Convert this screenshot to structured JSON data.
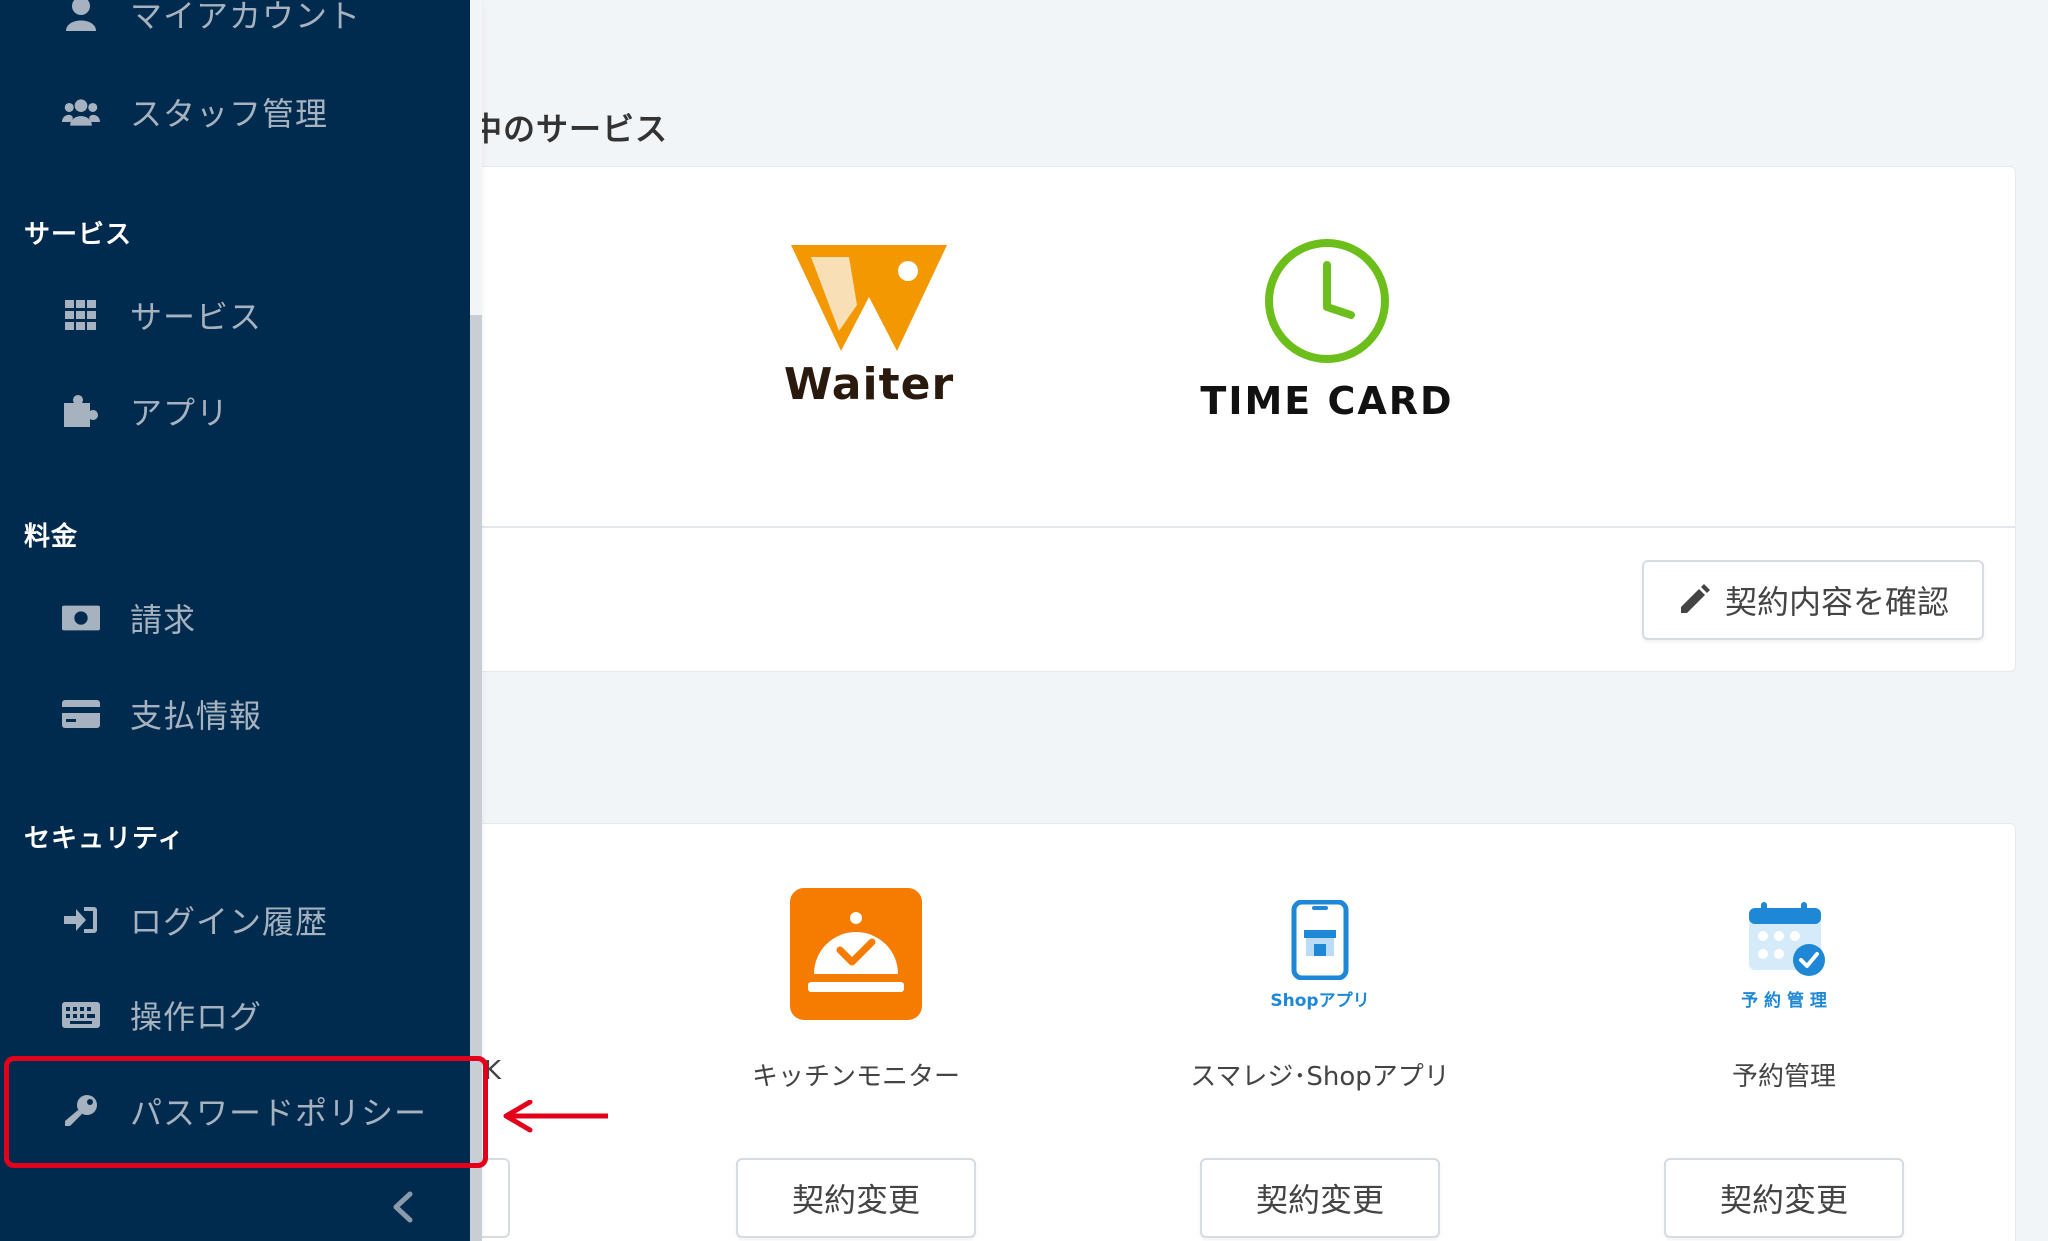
{
  "main": {
    "section_title": "中のサービス",
    "services": [
      {
        "name": "Waiter",
        "logo_color": "#f39800"
      },
      {
        "name": "TIME CARD",
        "logo_color": "#6cbf1a"
      }
    ],
    "confirm_button": "契約内容を確認",
    "partial_label": "K",
    "apps": [
      {
        "label": "キッチンモニター",
        "button": "契約変更",
        "icon_color": "#f57c00"
      },
      {
        "label": "スマレジ･Shopアプリ",
        "icon_caption": "Shopアプリ",
        "button": "契約変更",
        "icon_color": "#1e88d6"
      },
      {
        "label": "予約管理",
        "icon_caption": "予 約 管 理",
        "button": "契約変更",
        "icon_color": "#1e88d6"
      }
    ]
  },
  "sidebar": {
    "account_items": [
      {
        "label": "マイアカウント",
        "icon": "user-icon"
      },
      {
        "label": "スタッフ管理",
        "icon": "users-icon"
      }
    ],
    "groups": [
      {
        "heading": "サービス",
        "items": [
          {
            "label": "サービス",
            "icon": "grid-icon"
          },
          {
            "label": "アプリ",
            "icon": "puzzle-icon"
          }
        ]
      },
      {
        "heading": "料金",
        "items": [
          {
            "label": "請求",
            "icon": "money-icon"
          },
          {
            "label": "支払情報",
            "icon": "credit-card-icon"
          }
        ]
      },
      {
        "heading": "セキュリティ",
        "items": [
          {
            "label": "ログイン履歴",
            "icon": "sign-in-icon"
          },
          {
            "label": "操作ログ",
            "icon": "keyboard-icon"
          },
          {
            "label": "パスワードポリシー",
            "icon": "key-icon"
          }
        ]
      }
    ]
  },
  "colors": {
    "sidebar_bg": "#002b4e",
    "highlight": "#e3001b",
    "page_bg": "#f2f5f8"
  }
}
